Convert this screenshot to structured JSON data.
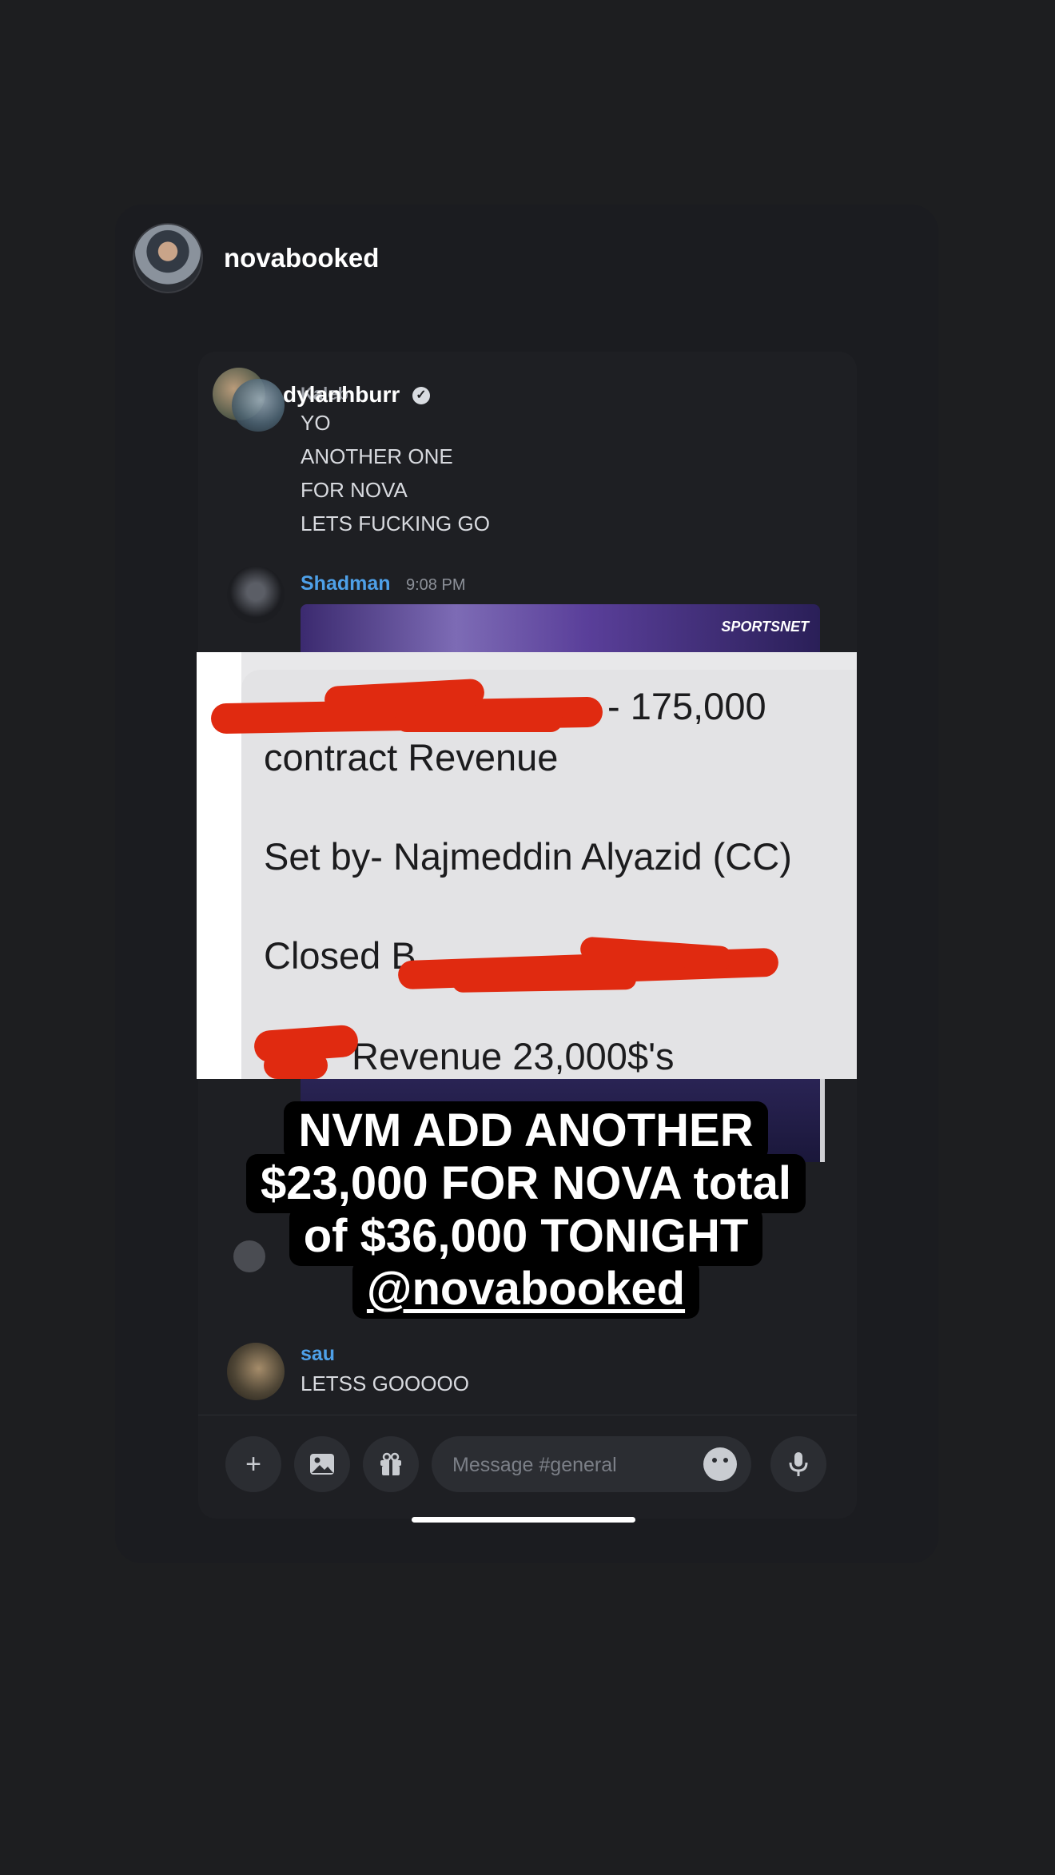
{
  "story": {
    "username": "novabooked"
  },
  "discord": {
    "overlap_name": "dylanhburr",
    "hidden_author": "Kaleb",
    "messages_first": {
      "lines": [
        "YO",
        "ANOTHER ONE",
        "FOR NOVA",
        "LETS FUCKING GO"
      ]
    },
    "message_shadman": {
      "author": "Shadman",
      "time": "9:08 PM",
      "embed_logo": "SPORTSNET"
    },
    "message_last": {
      "author": "sau",
      "text": "LETSS GOOOOO"
    },
    "composer": {
      "placeholder": "Message #general",
      "icons": [
        "plus-icon",
        "image-icon",
        "gift-icon",
        "emoji-icon",
        "mic-icon"
      ]
    }
  },
  "screenshot": {
    "line1_tail": "- 175,000",
    "line2": "contract Revenue",
    "line3": "Set by- Najmeddin Alyazid (CC)",
    "line4": "Closed B",
    "line5": "Revenue 23,000$'s"
  },
  "caption": {
    "line1": "NVM ADD ANOTHER",
    "line2": "$23,000 FOR NOVA total",
    "line3": "of $36,000 TONIGHT",
    "mention": "@novabooked"
  },
  "colors": {
    "background": "#1d1e20",
    "discord_bg": "#1e1f23",
    "link_blue": "#4ea0e8",
    "redaction": "#e02a10"
  }
}
